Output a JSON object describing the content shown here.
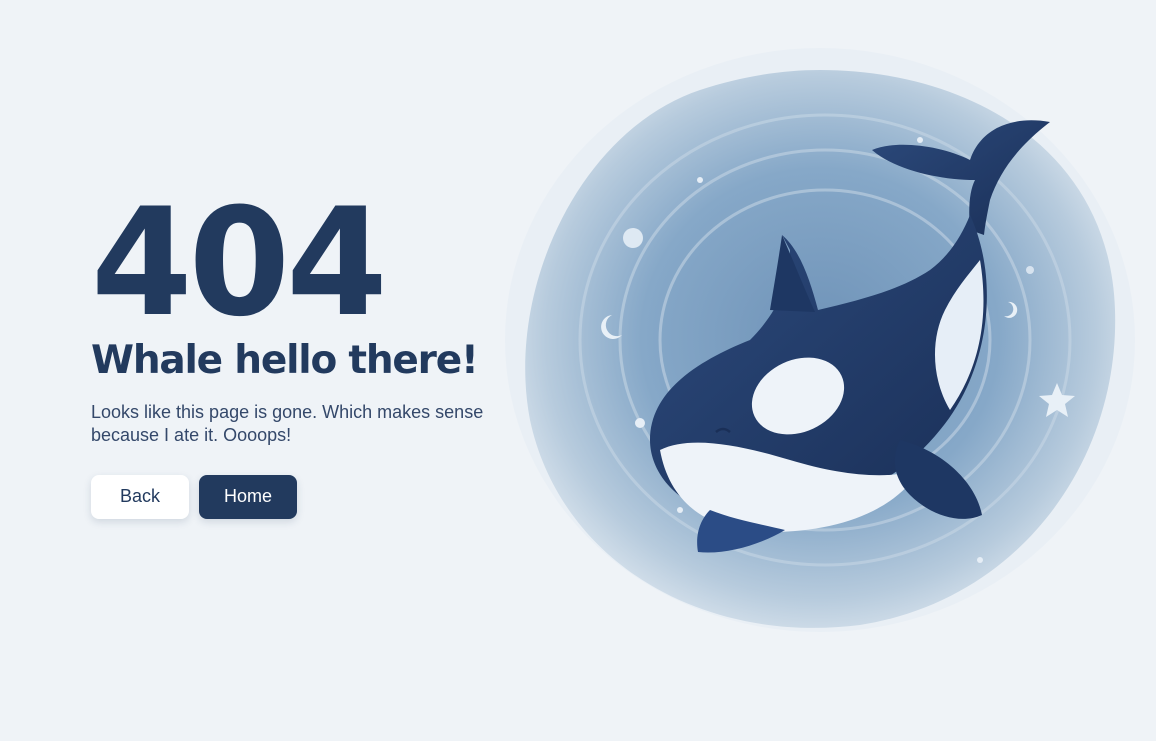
{
  "error": {
    "code": "404",
    "title": "Whale hello there!",
    "description": "Looks like this page is gone. Which makes sense because I ate it. Oooops!"
  },
  "buttons": {
    "back_label": "Back",
    "home_label": "Home"
  },
  "illustration": {
    "icon": "orca-whale-illustration"
  },
  "colors": {
    "background": "#eff3f7",
    "navy": "#223a5e",
    "button_light": "#ffffff"
  }
}
